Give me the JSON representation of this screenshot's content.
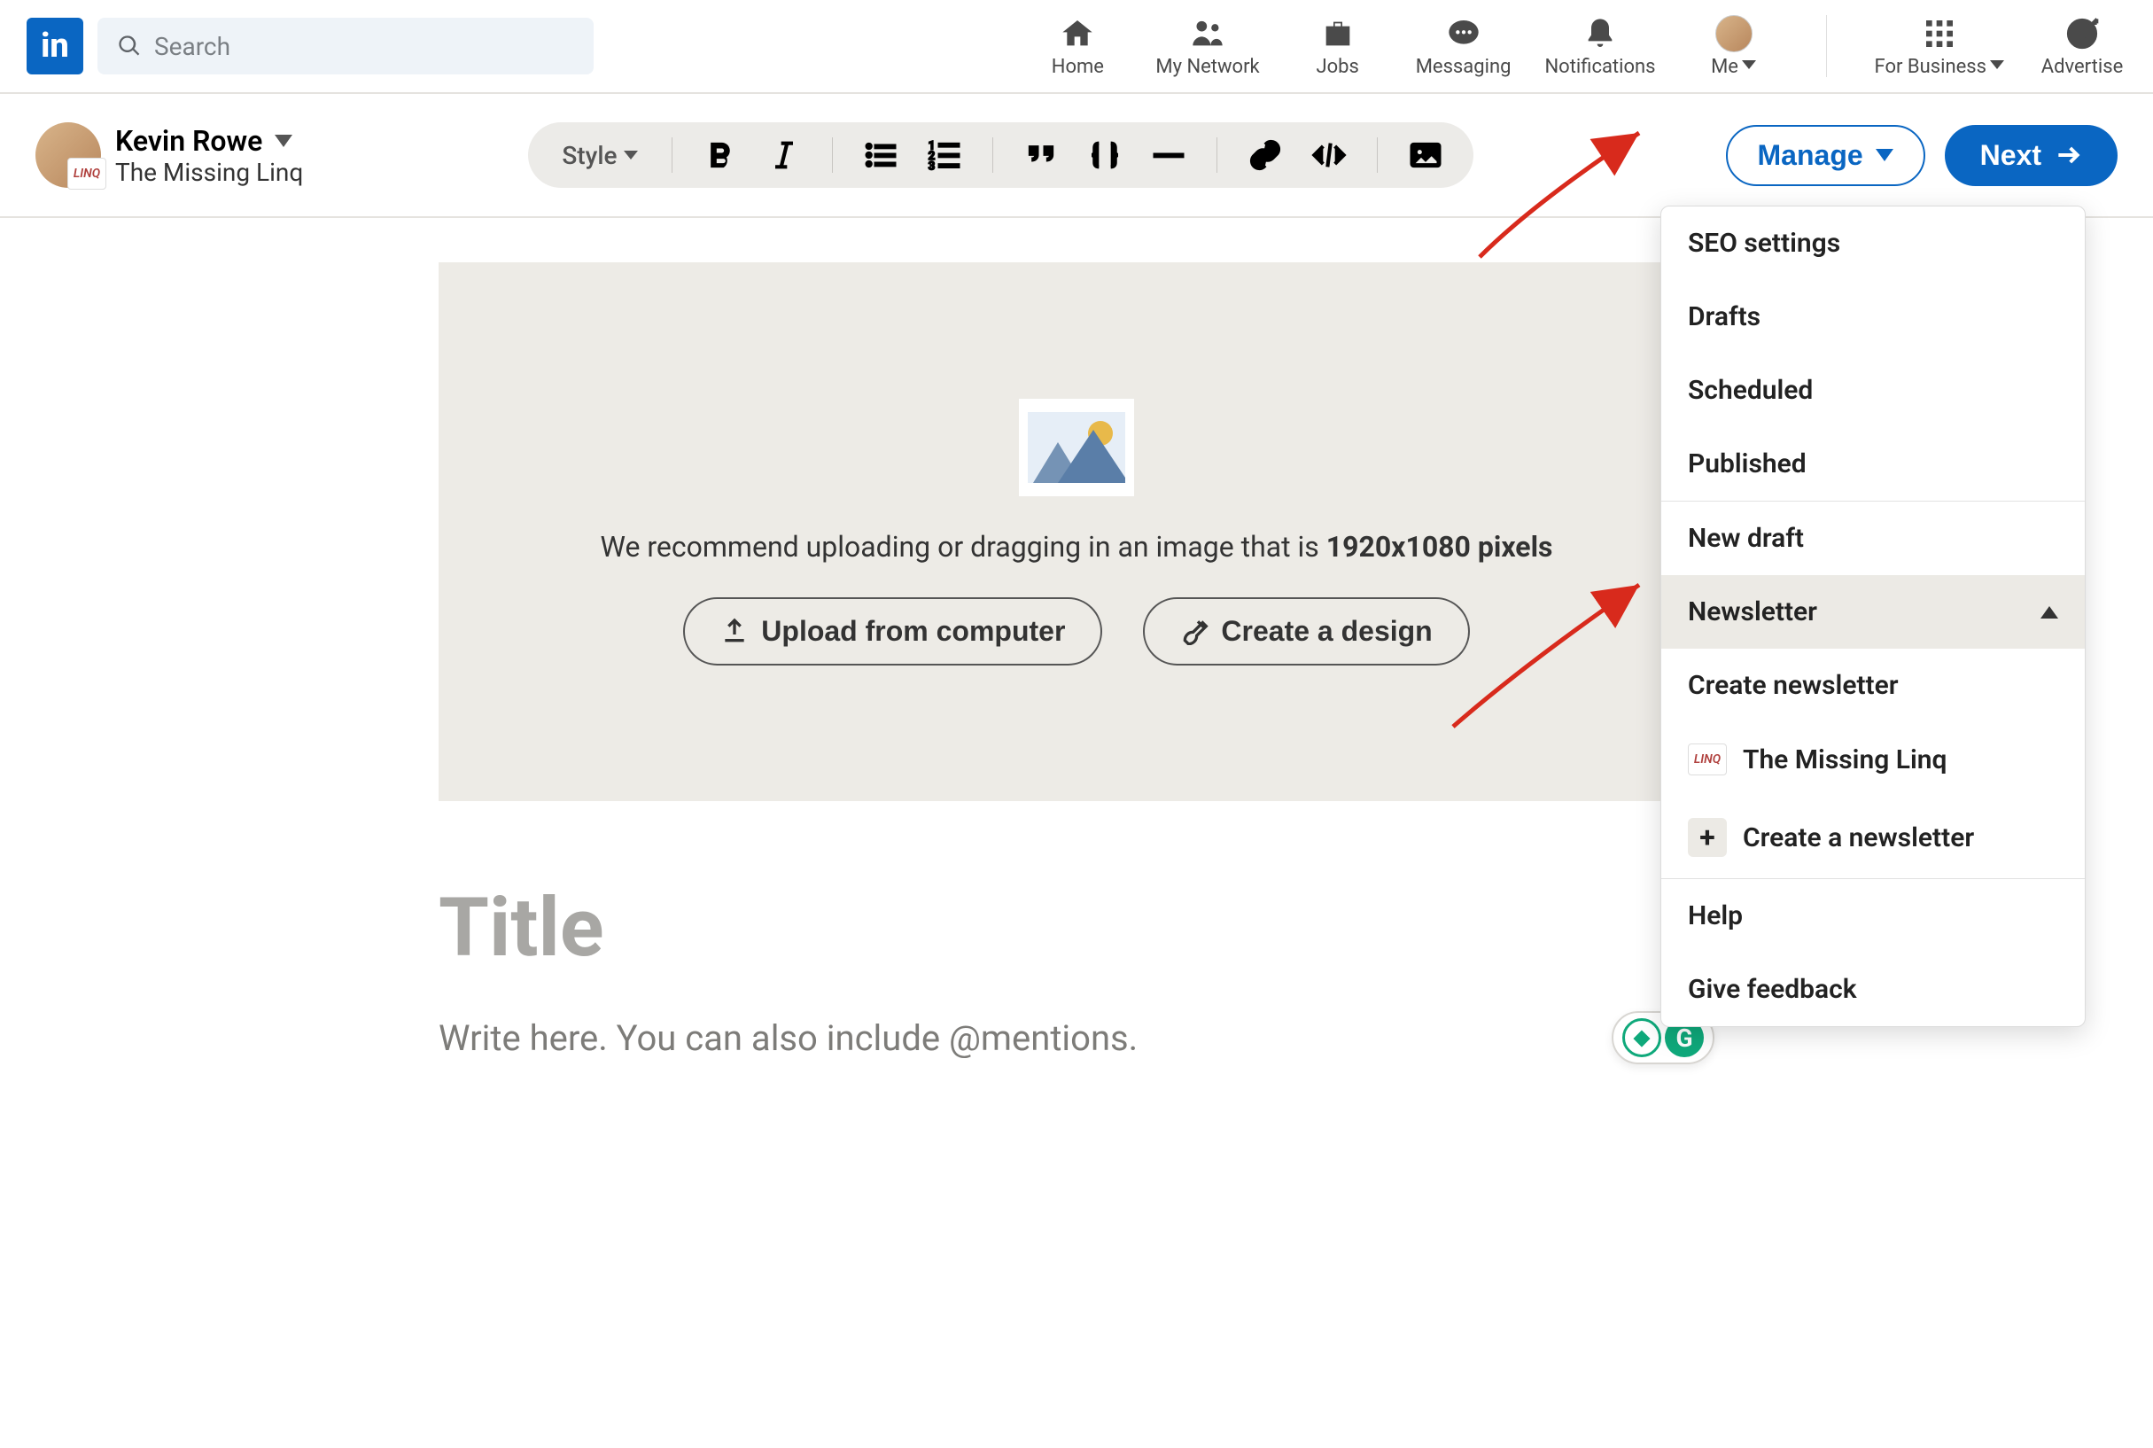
{
  "search": {
    "placeholder": "Search"
  },
  "nav": {
    "home": "Home",
    "network": "My Network",
    "jobs": "Jobs",
    "messaging": "Messaging",
    "notifications": "Notifications",
    "me": "Me",
    "business": "For Business",
    "advertise": "Advertise"
  },
  "author": {
    "name": "Kevin Rowe",
    "subtitle": "The Missing Linq",
    "badge": "LINQ"
  },
  "toolbar": {
    "style_label": "Style"
  },
  "actions": {
    "manage": "Manage",
    "next": "Next"
  },
  "upload": {
    "recommend_prefix": "We recommend uploading or dragging in an image that is ",
    "recommend_bold": "1920x1080 pixels",
    "upload_btn": "Upload from computer",
    "design_btn": "Create a design"
  },
  "editor": {
    "title_placeholder": "Title",
    "body_placeholder": "Write here. You can also include @mentions."
  },
  "dropdown": {
    "seo": "SEO settings",
    "drafts": "Drafts",
    "scheduled": "Scheduled",
    "published": "Published",
    "newdraft": "New draft",
    "newsletter": "Newsletter",
    "create_newsletter": "Create newsletter",
    "newsletter_item": "The Missing Linq",
    "create_a_newsletter": "Create a newsletter",
    "help": "Help",
    "feedback": "Give feedback",
    "nl_badge": "LINQ"
  }
}
